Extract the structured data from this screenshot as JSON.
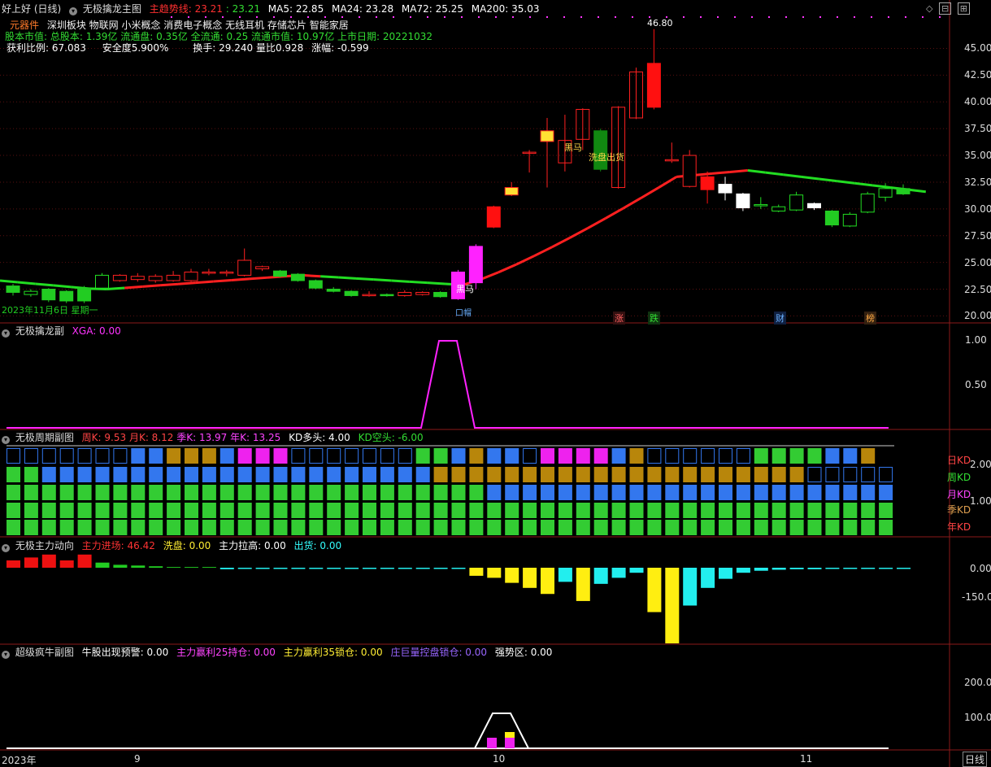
{
  "header": {
    "title": "好上好 (日线)",
    "indicator_name": "无极擒龙主图",
    "trend_label": "主趋势线:",
    "trend_value_a": "23.21",
    "trend_value_b": ": 23.21",
    "ma5": "MA5: 22.85",
    "ma24": "MA24: 23.28",
    "ma72": "MA72: 25.25",
    "ma200": "MA200: 35.03"
  },
  "info": {
    "line1_tag": "元器件",
    "line1_text": "深圳板块   物联网 小米概念 消费电子概念 无线耳机 存储芯片 智能家居",
    "line2": "股本市值: 总股本: 1.39亿 流通盘: 0.35亿 全流通: 0.25 流通市值: 10.97亿 上市日期: 20221032",
    "line3_a": "获利比例: 67.083",
    "line3_b": "安全度5.900%",
    "line3_c": "换手: 29.240 量比0.928",
    "line3_d": "涨幅: -0.599"
  },
  "main_chart": {
    "y_ticks": [
      "45.00",
      "42.50",
      "40.00",
      "37.50",
      "35.00",
      "32.50",
      "30.00",
      "27.50",
      "25.00",
      "22.50",
      "20.00"
    ],
    "high_label": "46.80",
    "annotations": {
      "heima1": "黑马",
      "xipan": "洗盘出货",
      "heima2": "黑马",
      "date_note": "2023年11月6日 星期一",
      "tiny_mark": "口帽"
    },
    "bottom_tags": [
      "涨",
      "跌",
      "财",
      "榜"
    ],
    "colors": {
      "up": "#ff2020",
      "down": "#22cc22",
      "magenta": "#ff22ff",
      "trend_red": "#ff2020",
      "trend_green": "#22dd22"
    }
  },
  "panel2": {
    "name": "无极擒龙副",
    "legend": "XGA: 0.00",
    "y_ticks": [
      "1.00",
      "0.50"
    ]
  },
  "panel3": {
    "name": "无极周期副图",
    "legend": {
      "week": "周K: 9.53",
      "month": "月K: 8.12",
      "quarter": "季K: 13.97",
      "year": "年K: 13.25",
      "kd_long": "KD多头: 4.00",
      "kd_short": "KD空头: -6.00"
    },
    "y_ticks": [
      "2.00",
      "1.00"
    ],
    "row_labels": [
      "日KD",
      "周KD",
      "月KD",
      "季KD",
      "年KD"
    ]
  },
  "panel4": {
    "name": "无极主力动向",
    "legend": {
      "enter": "主力进场: 46.42",
      "wash": "洗盘: 0.00",
      "pull": "主力拉高: 0.00",
      "out": "出货: 0.00"
    },
    "y_ticks": [
      "0.00",
      "-150.00"
    ]
  },
  "panel5": {
    "name": "超级疯牛副图",
    "legend": {
      "warn": "牛股出现预警: 0.00",
      "hold25": "主力赢利25持仓: 0.00",
      "lock35": "主力赢利35锁仓: 0.00",
      "control": "庄巨量控盘锁仓: 0.00",
      "strong": "强势区: 0.00"
    },
    "y_ticks": [
      "200.00",
      "100.00"
    ]
  },
  "x_axis": {
    "labels": [
      "2023年",
      "9",
      "10",
      "11"
    ],
    "period": "日线"
  },
  "chart_data": {
    "type": "candlestick",
    "ylim": [
      19.5,
      48
    ],
    "candles": [
      [
        22.8,
        22.2,
        23.0,
        21.9
      ],
      [
        22.0,
        22.3,
        22.5,
        21.8
      ],
      [
        22.5,
        21.5,
        22.6,
        21.3
      ],
      [
        22.3,
        21.4,
        22.4,
        21.2
      ],
      [
        22.6,
        21.4,
        22.8,
        21.2
      ],
      [
        22.6,
        23.8,
        24.0,
        22.5
      ],
      [
        23.3,
        23.8,
        23.9,
        23.2
      ],
      [
        23.4,
        23.7,
        24.0,
        23.2
      ],
      [
        23.3,
        23.7,
        23.9,
        23.1
      ],
      [
        23.3,
        23.8,
        24.2,
        23.2
      ],
      [
        23.3,
        24.1,
        24.4,
        23.2
      ],
      [
        24.0,
        24.1,
        24.4,
        23.8
      ],
      [
        24.0,
        24.1,
        24.3,
        23.7
      ],
      [
        23.8,
        25.2,
        26.3,
        23.7
      ],
      [
        24.4,
        24.6,
        24.7,
        24.2
      ],
      [
        24.2,
        23.7,
        24.3,
        23.6
      ],
      [
        23.9,
        23.3,
        24.0,
        23.2
      ],
      [
        23.3,
        22.6,
        23.4,
        22.5
      ],
      [
        22.5,
        22.3,
        22.7,
        22.2
      ],
      [
        22.3,
        21.9,
        22.4,
        21.8
      ],
      [
        22.0,
        22.0,
        22.3,
        21.8
      ],
      [
        22.0,
        21.9,
        22.1,
        21.8
      ],
      [
        21.9,
        22.2,
        22.4,
        21.8
      ],
      [
        22.0,
        22.2,
        22.3,
        21.9
      ],
      [
        22.2,
        21.8,
        22.3,
        21.7
      ],
      [
        21.6,
        24.1,
        24.3,
        21.5
      ],
      [
        23.1,
        26.5,
        26.7,
        22.5
      ],
      [
        28.3,
        30.2,
        30.3,
        28.2
      ],
      [
        31.3,
        32.0,
        32.5,
        31.2
      ],
      [
        35.2,
        35.3,
        35.5,
        33.4
      ],
      [
        36.3,
        37.3,
        38.5,
        32.0
      ],
      [
        34.3,
        36.4,
        38.8,
        33.5
      ],
      [
        36.5,
        39.3,
        39.4,
        35.5
      ],
      [
        37.3,
        33.7,
        37.5,
        33.5
      ],
      [
        32.0,
        39.5,
        39.6,
        31.9
      ],
      [
        38.5,
        42.8,
        43.2,
        38.4
      ],
      [
        39.5,
        43.6,
        46.8,
        39.3
      ],
      [
        34.6,
        34.6,
        36.2,
        34.3
      ],
      [
        32.1,
        35.0,
        35.5,
        32.0
      ],
      [
        33.0,
        31.8,
        33.5,
        30.5
      ],
      [
        31.5,
        32.3,
        33.0,
        30.8
      ],
      [
        31.4,
        30.1,
        31.5,
        29.8
      ],
      [
        30.3,
        30.4,
        31.1,
        30.0
      ],
      [
        29.8,
        30.2,
        30.4,
        29.7
      ],
      [
        29.9,
        31.3,
        31.6,
        29.8
      ],
      [
        30.1,
        30.5,
        30.6,
        29.9
      ],
      [
        29.8,
        28.5,
        29.9,
        28.3
      ],
      [
        28.4,
        29.5,
        29.7,
        28.3
      ],
      [
        29.7,
        31.4,
        31.6,
        29.6
      ],
      [
        31.1,
        31.9,
        32.4,
        30.7
      ],
      [
        31.9,
        31.4,
        32.3,
        31.3
      ]
    ],
    "special_magenta": [
      25,
      26
    ],
    "red_body": [
      27
    ],
    "white_body": [
      40,
      41,
      45
    ]
  }
}
